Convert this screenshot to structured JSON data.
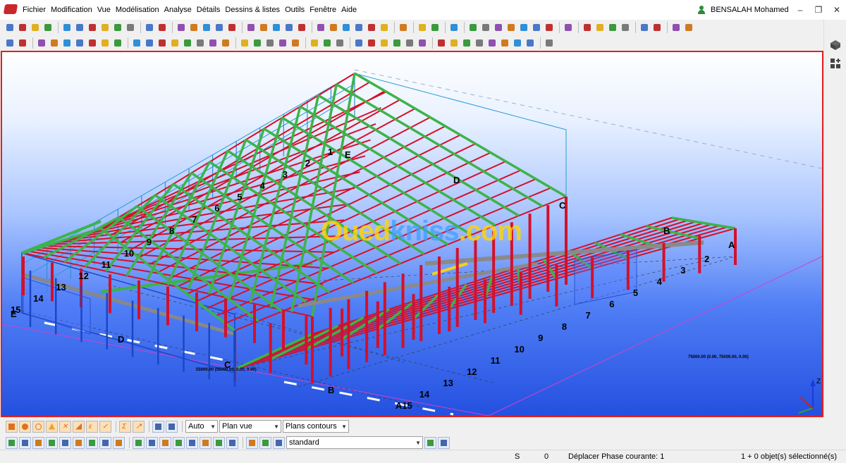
{
  "menu": {
    "items": [
      "Fichier",
      "Modification",
      "Vue",
      "Modélisation",
      "Analyse",
      "Détails",
      "Dessins & listes",
      "Outils",
      "Fenêtre",
      "Aide"
    ]
  },
  "user": {
    "name": "BENSALAH Mohamed"
  },
  "viewport": {
    "watermark_part1": "Oued",
    "watermark_part2": "kniss",
    "watermark_part3": ".com",
    "coord_left": "55000.00 (55000.00, 0.00, 0.00)",
    "coord_right": "75000.00 (0.00, 75000.00, 0.00)",
    "grid_right_numbers": [
      "2",
      "3",
      "4",
      "5",
      "6",
      "7",
      "8",
      "9",
      "10",
      "11",
      "12",
      "13",
      "14",
      "A15"
    ],
    "grid_letters_right": [
      "A",
      "B",
      "C",
      "D",
      "E"
    ],
    "grid_left_numbers": [
      "1",
      "2",
      "3",
      "4",
      "5",
      "6",
      "7",
      "8",
      "9",
      "10",
      "11",
      "12",
      "13",
      "14",
      "15"
    ],
    "grid_letters_front": [
      "D",
      "C",
      "B",
      "E"
    ],
    "axis_z": "Z"
  },
  "bottom_toolbar": {
    "auto": "Auto",
    "view": "Plan vue",
    "contours": "Plans contours",
    "standard": "standard"
  },
  "status": {
    "s": "S",
    "zero": "0",
    "message": "Déplacer Phase courante: 1",
    "selection": "1 + 0 objet(s) sélectionné(s)"
  },
  "colors": {
    "accent_red": "#e02020",
    "column_red": "#d4102a",
    "purlin_green": "#3db34a",
    "frame_blue": "#1a46c8"
  }
}
